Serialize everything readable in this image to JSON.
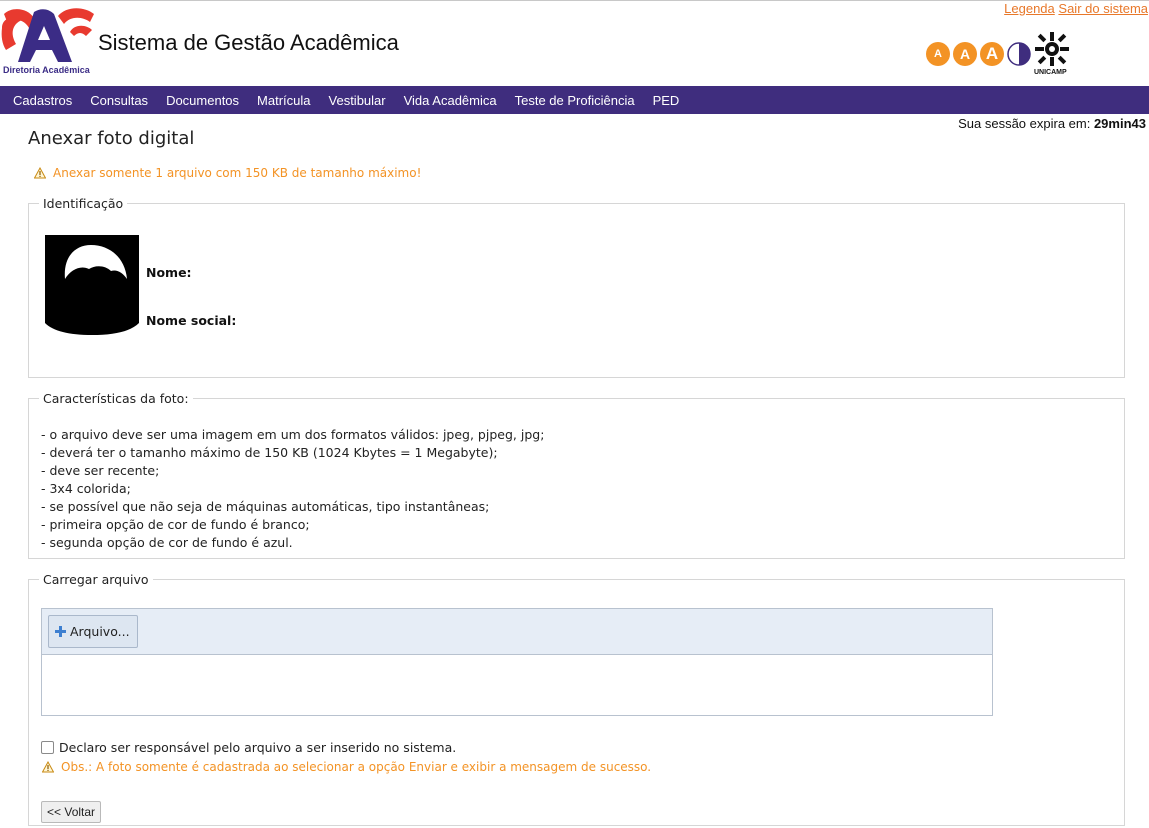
{
  "header": {
    "logo_caption": "Diretoria Acadêmica",
    "app_title": "Sistema de Gestão Acadêmica",
    "links": {
      "legend": "Legenda",
      "logout": "Sair do sistema"
    },
    "a11y": {
      "small": "A",
      "medium": "A",
      "large": "A"
    },
    "unicamp_caption": "UNICAMP",
    "colors": {
      "brand_orange": "#f39325",
      "brand_purple": "#3f2d7e",
      "logo_red": "#e83a2f",
      "logo_blue": "#3b2c86"
    }
  },
  "nav": {
    "items": [
      "Cadastros",
      "Consultas",
      "Documentos",
      "Matrícula",
      "Vestibular",
      "Vida Acadêmica",
      "Teste de Proficiência",
      "PED"
    ]
  },
  "session": {
    "label": "Sua sessão expira em:",
    "time": "29min43"
  },
  "page": {
    "title": "Anexar foto digital",
    "warning": "Anexar somente 1 arquivo com 150 KB de tamanho máximo!"
  },
  "identificacao": {
    "legend": "Identificação",
    "nome_label": "Nome:",
    "nome_social_label": "Nome social:"
  },
  "caracteristicas": {
    "legend": "Características da foto:",
    "items": [
      "- o arquivo deve ser uma imagem em um dos formatos válidos: jpeg, pjpeg, jpg;",
      "- deverá ter o tamanho máximo de 150 KB (1024 Kbytes = 1 Megabyte);",
      "- deve ser recente;",
      "- 3x4 colorida;",
      "- se possível que não seja de máquinas automáticas, tipo instantâneas;",
      "- primeira opção de cor de fundo é branco;",
      "- segunda opção de cor de fundo é azul."
    ]
  },
  "carregar": {
    "legend": "Carregar arquivo",
    "file_button": "Arquivo...",
    "declare_label": "Declaro ser responsável pelo arquivo a ser inserido no sistema.",
    "obs": "Obs.: A foto somente é cadastrada ao selecionar a opção Enviar e exibir a mensagem de sucesso.",
    "back_button": "<< Voltar"
  }
}
